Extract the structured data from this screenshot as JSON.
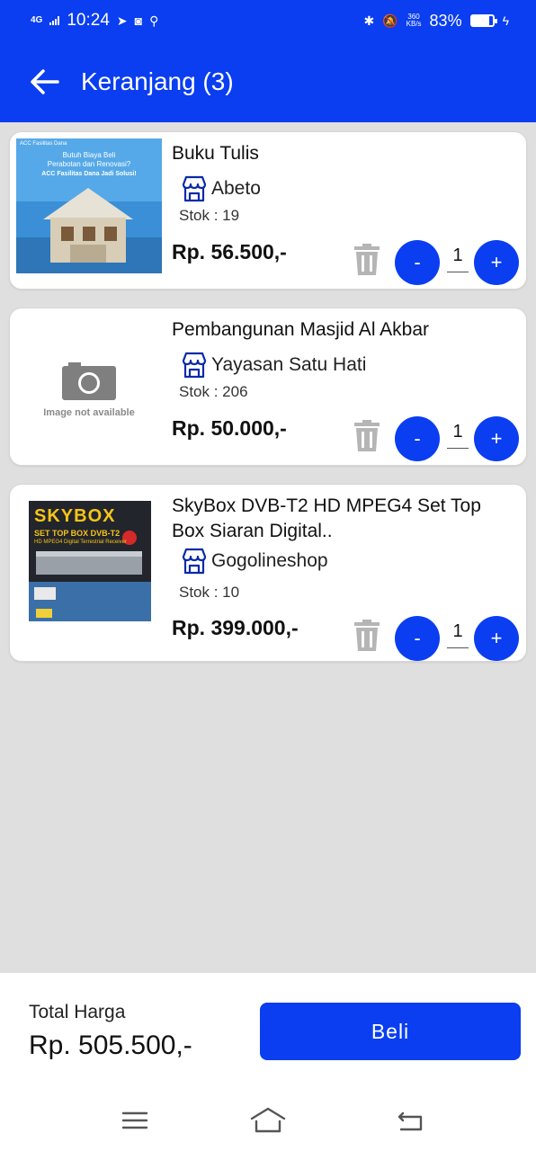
{
  "status_bar": {
    "network": "4G",
    "time": "10:24",
    "speed_top": "360",
    "speed_bottom": "KB/s",
    "battery": "83%",
    "battery_level": 0.83
  },
  "header": {
    "title": "Keranjang (3)"
  },
  "cart": {
    "items": [
      {
        "name": "Buku Tulis",
        "store": "Abeto",
        "stok": "Stok : 19",
        "price": "Rp. 56.500,-",
        "qty": "1",
        "thumb": {
          "brand": "ACC Fasilitas Dana",
          "line1": "Butuh Biaya Beli",
          "line2": "Perabotan dan Renovasi?",
          "line3": "ACC Fasilitas Dana Jadi Solusi!"
        }
      },
      {
        "name": "Pembangunan Masjid Al Akbar",
        "store": "Yayasan Satu Hati",
        "stok": "Stok : 206",
        "price": "Rp. 50.000,-",
        "qty": "1",
        "thumb": {
          "placeholder": "Image not available"
        }
      },
      {
        "name": "SkyBox DVB-T2 HD MPEG4 Set Top Box Siaran Digital..",
        "store": "Gogolineshop",
        "stok": "Stok : 10",
        "price": "Rp. 399.000,-",
        "qty": "1",
        "thumb": {
          "brand": "SKYBOX",
          "line1": "SET TOP BOX DVB-T2",
          "line2": "HD MPEG4 Digital Terrestrial Receiver"
        }
      }
    ],
    "minus_label": "-",
    "plus_label": "+"
  },
  "footer": {
    "total_label": "Total Harga",
    "total_value": "Rp. 505.500,-",
    "buy_label": "Beli"
  },
  "icons": [
    "back-arrow-icon",
    "store-icon",
    "trash-icon",
    "menu-icon",
    "home-icon",
    "return-icon"
  ],
  "colors": {
    "primary": "#0a3ef0",
    "background": "#dfdfdf",
    "card": "#ffffff",
    "icon_gray": "#b5b5b5"
  }
}
